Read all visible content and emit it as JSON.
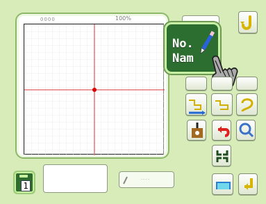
{
  "screen": {
    "title_left": "0000",
    "title_center": "100%"
  },
  "toolbar": {
    "big_button_line1": "No.",
    "big_button_line2": "Nam",
    "small_label_1": "",
    "small_label_2": "",
    "small_label_3": "",
    "small_label_4": ""
  },
  "bottom": {
    "counter_value": "1",
    "status_text": "",
    "mini_text": "- - - -"
  },
  "colors": {
    "bg": "#d7ecb8",
    "grid_line": "#e6e6e6",
    "axis_line": "#d83a3a",
    "accent": "#2c6d30"
  },
  "icons": {
    "hand": "hand-pointer-icon",
    "refresh": "refresh-icon",
    "zoom": "zoom-icon",
    "arrow": "arrow-icon"
  }
}
